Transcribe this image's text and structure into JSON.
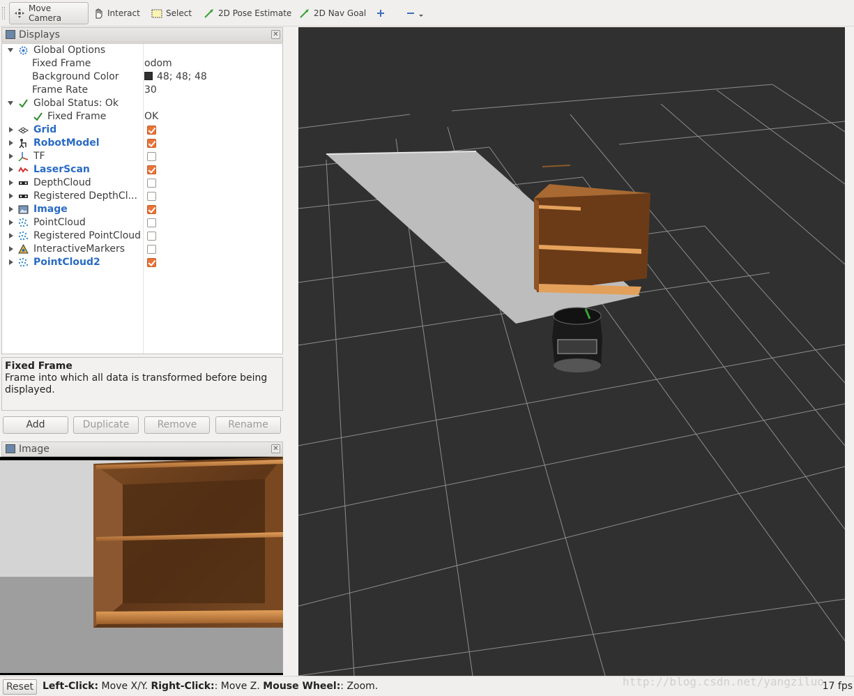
{
  "toolbar": {
    "tools": [
      {
        "label": "Move Camera",
        "icon": "move-camera-icon",
        "active": true
      },
      {
        "label": "Interact",
        "icon": "hand-icon"
      },
      {
        "label": "Select",
        "icon": "select-box-icon"
      },
      {
        "label": "2D Pose Estimate",
        "icon": "green-arrow-icon"
      },
      {
        "label": "2D Nav Goal",
        "icon": "green-arrow-icon"
      },
      {
        "label": "",
        "icon": "plus-icon"
      },
      {
        "label": "",
        "icon": "minus-dropdown-icon"
      }
    ]
  },
  "displays_panel": {
    "title": "Displays",
    "rows": [
      {
        "label": "Global Options",
        "icon": "gear-icon",
        "expanded": true
      },
      {
        "label": "Fixed Frame",
        "value": "odom"
      },
      {
        "label": "Background Color",
        "value": "48; 48; 48",
        "swatch": "#303030"
      },
      {
        "label": "Frame Rate",
        "value": "30"
      },
      {
        "label": "Global Status: Ok",
        "icon": "check-icon",
        "expanded": true
      },
      {
        "label": "Fixed Frame",
        "value": "OK",
        "icon": "check-icon"
      },
      {
        "label": "Grid",
        "icon": "grid-icon",
        "checked": true,
        "highlight": true
      },
      {
        "label": "RobotModel",
        "icon": "robot-icon",
        "checked": true,
        "highlight": true
      },
      {
        "label": "TF",
        "icon": "axes-icon",
        "checked": false
      },
      {
        "label": "LaserScan",
        "icon": "laser-icon",
        "checked": true,
        "highlight": true
      },
      {
        "label": "DepthCloud",
        "icon": "depth-camera-icon",
        "checked": false
      },
      {
        "label": "Registered DepthCl...",
        "icon": "depth-camera-icon",
        "checked": false
      },
      {
        "label": "Image",
        "icon": "image-icon",
        "checked": true,
        "highlight": true
      },
      {
        "label": "PointCloud",
        "icon": "pointcloud-icon",
        "checked": false
      },
      {
        "label": "Registered PointCloud",
        "icon": "pointcloud-icon",
        "checked": false
      },
      {
        "label": "InteractiveMarkers",
        "icon": "markers-icon",
        "checked": false
      },
      {
        "label": "PointCloud2",
        "icon": "pointcloud-icon",
        "checked": true,
        "highlight": true
      }
    ],
    "description_title": "Fixed Frame",
    "description_text": "Frame into which all data is transformed before being displayed.",
    "buttons": {
      "add": "Add",
      "duplicate": "Duplicate",
      "remove": "Remove",
      "rename": "Rename"
    }
  },
  "image_panel": {
    "title": "Image"
  },
  "statusbar": {
    "reset": "Reset",
    "help_parts": [
      "Left-Click:",
      " Move X/Y. ",
      "Right-Click:",
      ": Move Z. ",
      "Mouse Wheel:",
      ": Zoom."
    ],
    "fps": "17 fps"
  },
  "watermark": "http://blog.csdn.net/yangziluo",
  "colors": {
    "background": "#303030",
    "accent": "#e8743b",
    "highlight_text": "#2a6bc4"
  }
}
